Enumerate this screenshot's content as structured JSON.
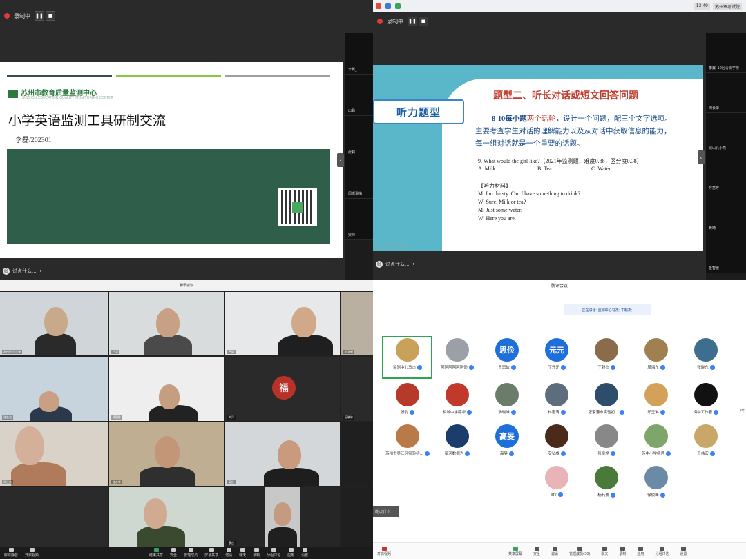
{
  "q1": {
    "rec_label": "录制中",
    "pause": "❚❚",
    "stop": "■",
    "slide": {
      "org": "苏州市教育质量监测中心",
      "org_sub": "SUZHOU EDUCATION QUALITY MONITORING CENTER",
      "title": "小学英语监测工具研制交流",
      "author": "李磊/202301",
      "bar_colors": [
        "#3a4a5a",
        "#8cc63f",
        "#9aa0a6"
      ]
    },
    "sidebar_names": [
      "李翼_",
      "出勤",
      "张莉",
      "周岚夏梅",
      "梁帅",
      ""
    ],
    "chat_placeholder": "说点什么...",
    "collapse": "‹"
  },
  "q2": {
    "rec_label": "录制中",
    "pause": "❚❚",
    "stop": "■",
    "clock": "13:49",
    "window_name": "苏州市考试院",
    "slide": {
      "heading": "题型二、听长对话或短文回答问题",
      "badge": "听力题型",
      "para_1a": "8-10每小题",
      "para_1b": "两个话轮",
      "para_1c": "，设计一个问题，配三个文字选项。",
      "para_2": "主要考查学生对话的理解能力以及从对话中获取信息的能力，",
      "para_3": "每一组对话就是一个重要的话题。",
      "q9": "9. What would the girl like?（2021年监测题，难度0.88，区分度0.38）",
      "opt_a": "A. Milk.",
      "opt_b": "B. Tea.",
      "opt_c": "C. Water.",
      "material": "【听力材料】",
      "m1": "M: I'm thirsty. Can I have something to drink?",
      "w1": "W: Sure. Milk or tea?",
      "m2": "M: Just some water.",
      "w2": "W: Here you are."
    },
    "sidebar_names": [
      "李翼_10区青浦学校",
      "周长华",
      "昆山孔小燕",
      "万慧芳",
      "黄琦",
      "金智敏"
    ],
    "chat_placeholder": "说点什么...",
    "collapse": "‹"
  },
  "q3": {
    "window_title": "腾讯会议",
    "tiles": [
      {
        "name": "苏州外小 沈婷"
      },
      {
        "name": "卢剑"
      },
      {
        "name": "吕炳"
      },
      {
        "name": "刘学新"
      },
      {
        "name": "张金龙"
      },
      {
        "name": "杨国栋"
      },
      {
        "name": "刘洋"
      },
      {
        "name": "王晓林"
      },
      {
        "name": "周仁杰"
      },
      {
        "name": "张彦华"
      },
      {
        "name": "吴红"
      },
      {
        "name": "袁良"
      }
    ],
    "toolbar_left": [
      "解除静音",
      "开启视频"
    ],
    "toolbar_mid": [
      "结束共享",
      "安全",
      "管理成员",
      "屏幕共享",
      "邀请",
      "聊天",
      "录制",
      "分组讨论",
      "应用",
      "设置"
    ]
  },
  "q4": {
    "window_title": "腾讯会议",
    "speaking": "正在讲话: 监测中心马杰; 丁毅杰;",
    "attendees": [
      {
        "name": "监测中心马杰",
        "text": "",
        "color": "#c8a15a"
      },
      {
        "name": "阿阿阿阿阿阿仍",
        "text": "",
        "color": "#9aa0a6"
      },
      {
        "name": "王思俭",
        "text": "思俭",
        "color": "#1e6fd9"
      },
      {
        "name": "丁元元",
        "text": "元元",
        "color": "#1e6fd9"
      },
      {
        "name": "丁毅杰",
        "text": "",
        "color": "#8a6b4a"
      },
      {
        "name": "周海东",
        "text": "",
        "color": "#a08050"
      },
      {
        "name": "张晓东",
        "text": "",
        "color": "#3d6e8e"
      },
      {
        "name": "殷韵",
        "text": "",
        "color": "#b53a2a"
      },
      {
        "name": "相城中学薛华",
        "text": "",
        "color": "#c0392b"
      },
      {
        "name": "汤晓峰",
        "text": "",
        "color": "#6b7d6a"
      },
      {
        "name": "林惠清",
        "text": "",
        "color": "#5d6d7e"
      },
      {
        "name": "张家港市实验初...",
        "text": "",
        "color": "#2d4d6b"
      },
      {
        "name": "郑玉琳",
        "text": "",
        "color": "#d4a15a"
      },
      {
        "name": "梅中工作者",
        "text": "",
        "color": "#111111"
      },
      {
        "name": "苏州市吴江区实验初...",
        "text": "",
        "color": "#b97a4a"
      },
      {
        "name": "星河数据为",
        "text": "",
        "color": "#1a3d6b"
      },
      {
        "name": "高旻",
        "text": "高旻",
        "color": "#1e6fd9"
      },
      {
        "name": "安弘威",
        "text": "",
        "color": "#4a2a1a"
      },
      {
        "name": "张晓烨",
        "text": "",
        "color": "#888888"
      },
      {
        "name": "苏中小学杨君",
        "text": "",
        "color": "#7fa66a"
      },
      {
        "name": "王伟宏",
        "text": "",
        "color": "#c9a76a"
      },
      {
        "name": "lgy",
        "text": "",
        "color": "#e8b4b8"
      },
      {
        "name": "杨石波",
        "text": "",
        "color": "#4a7a3a"
      },
      {
        "name": "徐俊峰",
        "text": "",
        "color": "#6b8aa6"
      }
    ],
    "edge_name": "叶",
    "chat": "说点什么...",
    "toolbar_left": "开启视频",
    "toolbar_mid": [
      "共享屏幕",
      "安全",
      "邀请",
      "管理成员(30)",
      "聊天",
      "录制",
      "应用",
      "分组讨论",
      "设置"
    ]
  }
}
